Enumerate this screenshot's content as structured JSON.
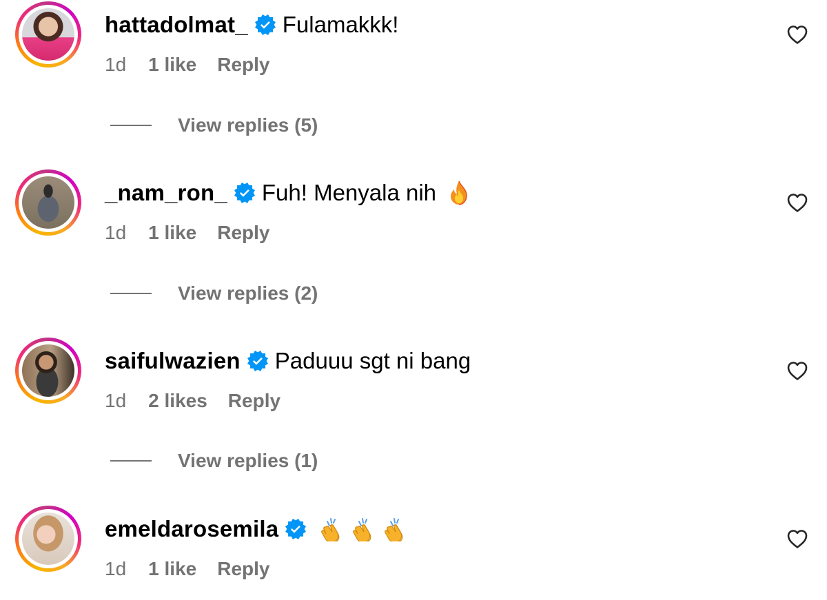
{
  "comments": [
    {
      "username": "hattadolmat_",
      "text": "Fulamakkk!",
      "emojis": [],
      "time": "1d",
      "likes": "1 like",
      "reply": "Reply",
      "view_replies": "View replies (5)"
    },
    {
      "username": "_nam_ron_",
      "text": "Fuh! Menyala nih",
      "emojis": [
        "fire-emoji"
      ],
      "time": "1d",
      "likes": "1 like",
      "reply": "Reply",
      "view_replies": "View replies (2)"
    },
    {
      "username": "saifulwazien",
      "text": "Paduuu sgt ni bang",
      "emojis": [],
      "time": "1d",
      "likes": "2 likes",
      "reply": "Reply",
      "view_replies": "View replies (1)"
    },
    {
      "username": "emeldarosemila",
      "text": "",
      "emojis": [
        "clapping-hands-emoji",
        "clapping-hands-emoji",
        "clapping-hands-emoji"
      ],
      "time": "1d",
      "likes": "1 like",
      "reply": "Reply"
    }
  ],
  "colors": {
    "verified": "#0095f6",
    "secondary_text": "#737373",
    "primary_text": "#000000"
  },
  "icons": {
    "verified": "verified-badge-icon",
    "like": "heart-outline-icon"
  }
}
